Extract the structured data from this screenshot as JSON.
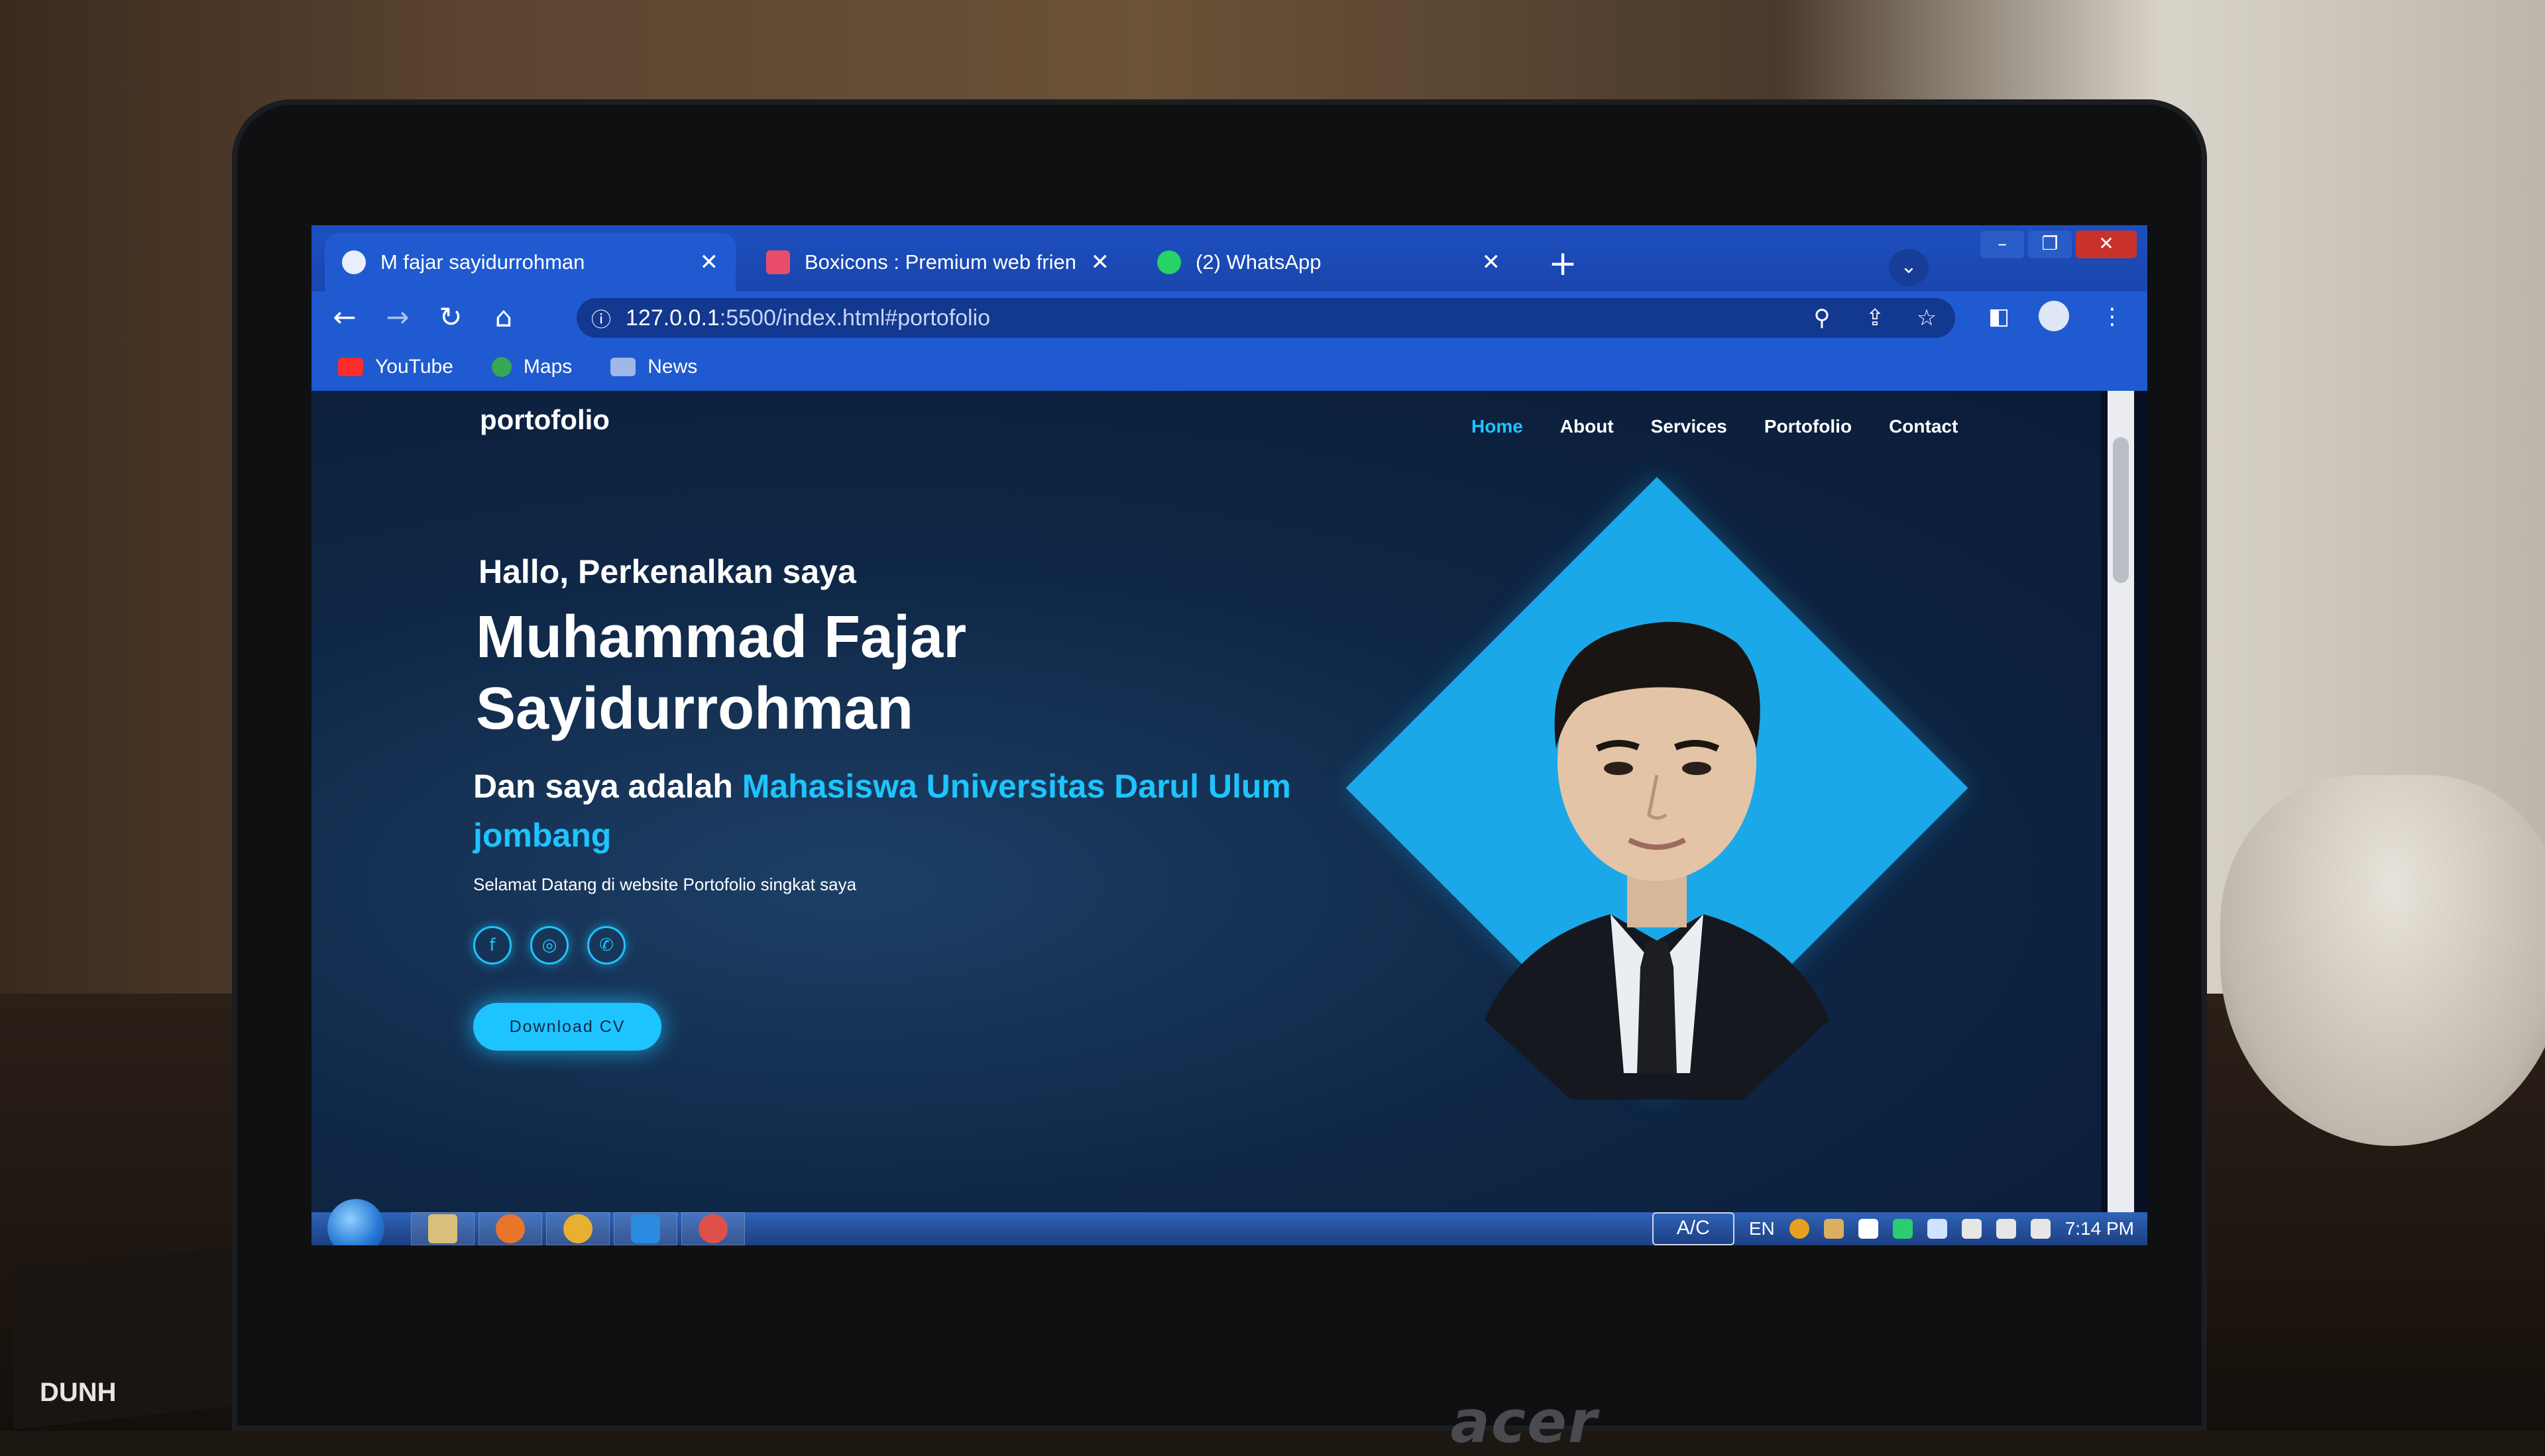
{
  "browser": {
    "tabs": [
      {
        "label": "M fajar sayidurrohman",
        "active": true,
        "icon": "globe-icon"
      },
      {
        "label": "Boxicons : Premium web friendly",
        "active": false,
        "icon": "boxicons-icon"
      },
      {
        "label": "(2) WhatsApp",
        "active": false,
        "icon": "whatsapp-icon"
      }
    ],
    "url_host": "127.0.0.1",
    "url_rest": ":5500/index.html#portofolio",
    "bookmarks": [
      {
        "label": "YouTube",
        "icon": "youtube-icon",
        "color": "#ff2a2a"
      },
      {
        "label": "Maps",
        "icon": "maps-icon",
        "color": "#35a853"
      },
      {
        "label": "News",
        "icon": "news-icon",
        "color": "#9fb8e8"
      }
    ]
  },
  "site": {
    "logo": "portofolio",
    "nav": [
      "Home",
      "About",
      "Services",
      "Portofolio",
      "Contact"
    ],
    "active_nav": "Home",
    "greeting": "Hallo, Perkenalkan saya",
    "name": "Muhammad Fajar Sayidurrohman",
    "role_prefix": "Dan saya adalah",
    "role_highlight": "Mahasiswa Universitas Darul Ulum jombang",
    "welcome": "Selamat Datang di website Portofolio singkat saya",
    "socials": [
      "facebook-icon",
      "instagram-icon",
      "whatsapp-icon"
    ],
    "cta": "Download CV",
    "accent_color": "#1ec4ff"
  },
  "taskbar": {
    "ac_label": "A/C",
    "lang": "EN",
    "time": "7:14 PM"
  },
  "laptop": {
    "brand": "acer"
  },
  "book": {
    "text": "DUNH"
  }
}
